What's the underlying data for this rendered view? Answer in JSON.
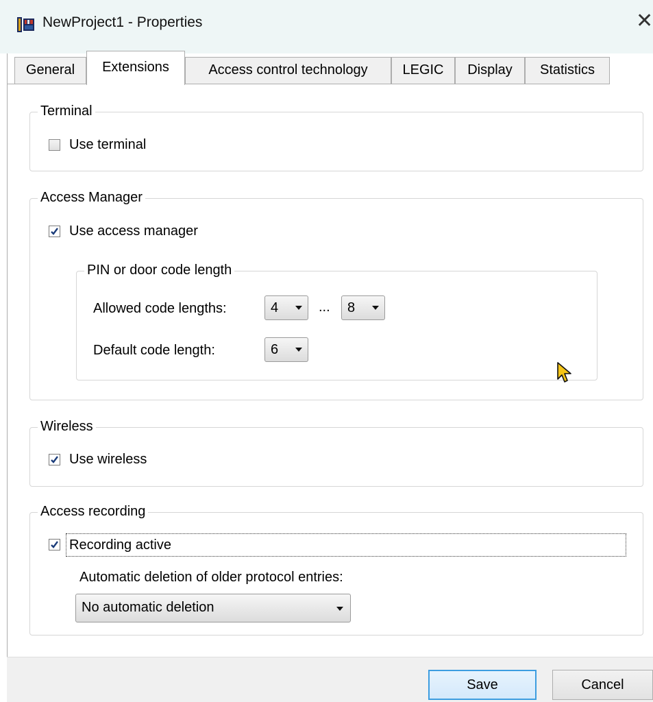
{
  "window": {
    "title": "NewProject1 - Properties",
    "close_glyph": "✕",
    "icon": "app-icon"
  },
  "tabs": [
    {
      "label": "General",
      "active": false
    },
    {
      "label": "Extensions",
      "active": true
    },
    {
      "label": "Access control technology",
      "active": false
    },
    {
      "label": "LEGIC",
      "active": false
    },
    {
      "label": "Display",
      "active": false
    },
    {
      "label": "Statistics",
      "active": false
    }
  ],
  "terminal": {
    "legend": "Terminal",
    "use_label": "Use terminal",
    "checked": false
  },
  "access_manager": {
    "legend": "Access Manager",
    "use_label": "Use access manager",
    "checked": true,
    "pin": {
      "legend": "PIN or door code length",
      "allowed_label": "Allowed code lengths:",
      "allowed_min": "4",
      "range_sep": "...",
      "allowed_max": "8",
      "default_label": "Default code length:",
      "default_value": "6"
    }
  },
  "wireless": {
    "legend": "Wireless",
    "use_label": "Use wireless",
    "checked": true
  },
  "access_recording": {
    "legend": "Access recording",
    "active_label": "Recording active",
    "checked": true,
    "deletion_label": "Automatic deletion of older protocol entries:",
    "deletion_value": "No automatic deletion"
  },
  "buttons": {
    "save": "Save",
    "cancel": "Cancel"
  },
  "colors": {
    "accent": "#3c9de0",
    "title_bg": "#eef6f6",
    "check": "#1b3c7a"
  }
}
